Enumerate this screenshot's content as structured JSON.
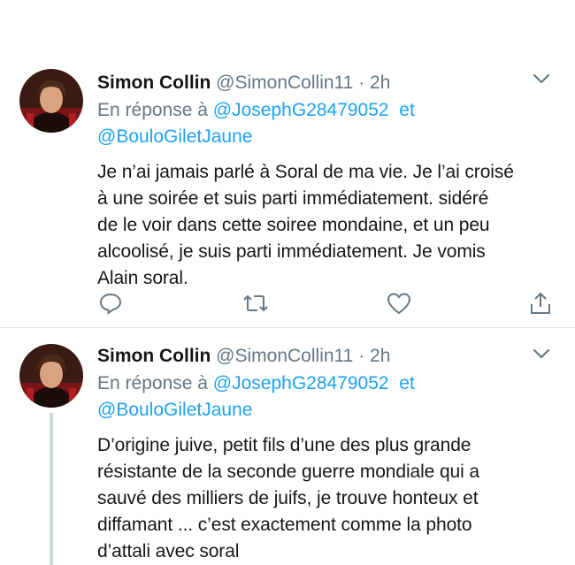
{
  "tweets": [
    {
      "author_name": "Simon Collin",
      "handle": "@SimonCollin11",
      "separator": "·",
      "time": "2h",
      "reply_prefix": "En réponse à",
      "reply_mention_1": "@JosephG28479052",
      "reply_connector": "et",
      "reply_mention_2": "@BouloGiletJaune",
      "text": "Je n’ai jamais parlé à Soral de ma vie. Je l’ai croisé\nà une soirée et suis parti immédiatement. sidéré\nde le voir dans cette soiree mondaine, et un peu\nalcoolisé, je suis parti immédiatement. Je vomis\nAlain soral."
    },
    {
      "author_name": "Simon Collin",
      "handle": "@SimonCollin11",
      "separator": "·",
      "time": "2h",
      "reply_prefix": "En réponse à",
      "reply_mention_1": "@JosephG28479052",
      "reply_connector": "et",
      "reply_mention_2": "@BouloGiletJaune",
      "text": "D’origine juive, petit fils d’une des plus grande\nrésistante de la seconde guerre mondiale qui a\nsauvé des milliers de juifs, je trouve honteux et\ndiffamant ... c’est exactement comme la photo\nd’attali avec soral"
    }
  ],
  "icons": {
    "reply": "reply-icon",
    "retweet": "retweet-icon",
    "like": "heart-icon",
    "share": "share-icon",
    "menu": "chevron-down-icon"
  },
  "colors": {
    "text": "#14171a",
    "secondary": "#657786",
    "link": "#1da1f2",
    "divider": "#e1e8ed"
  }
}
